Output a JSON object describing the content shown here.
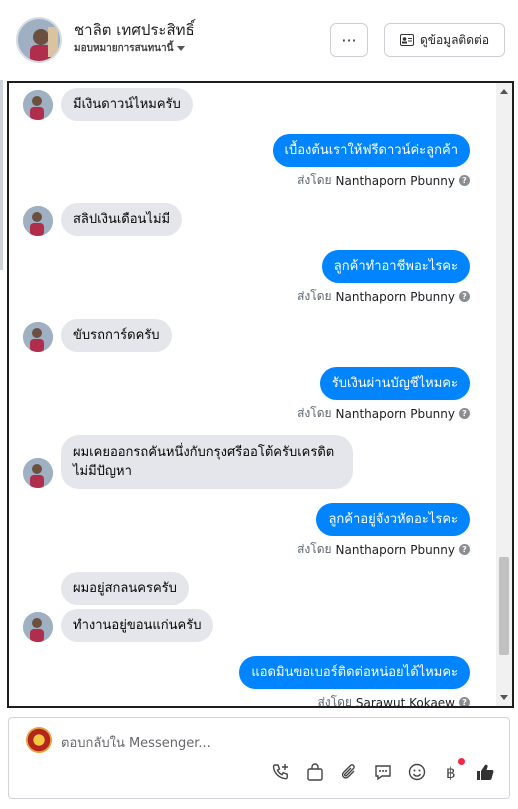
{
  "header": {
    "name": "ชาลิต เทศประสิทธิ์",
    "assigned": "มอบหมายการสนทนานี้",
    "more_label": "···",
    "contact_label": "ดูข้อมูลติดต่อ"
  },
  "messages": [
    {
      "dir": "in",
      "text": "มีเงินดาวน์ไหมครับ"
    },
    {
      "dir": "out",
      "text": "เบื้องต้นเราให้ฟรีดาวน์ค่ะลูกค้า",
      "sent_by_prefix": "ส่งโดย",
      "sender": "Nanthaporn Pbunny"
    },
    {
      "dir": "in",
      "text": "สลิปเงินเดือนไม่มี"
    },
    {
      "dir": "out",
      "text": "ลูกค้าทำอาชีพอะไรคะ",
      "sent_by_prefix": "ส่งโดย",
      "sender": "Nanthaporn Pbunny"
    },
    {
      "dir": "in",
      "text": "ขับรถการ์ดครับ"
    },
    {
      "dir": "out",
      "text": "รับเงินผ่านบัญชีไหมคะ",
      "sent_by_prefix": "ส่งโดย",
      "sender": "Nanthaporn Pbunny"
    },
    {
      "dir": "in",
      "text": "ผมเคยออกรถคันหนึ่งกับกรุงศรีออโต้ครับเครดิตไม่มีปัญหา"
    },
    {
      "dir": "out",
      "text": "ลูกค้าอยู่จังวหัดอะไรคะ",
      "sent_by_prefix": "ส่งโดย",
      "sender": "Nanthaporn Pbunny"
    },
    {
      "dir": "in",
      "text": "ผมอยู่สกลนครครับ"
    },
    {
      "dir": "in",
      "text": "ทำงานอยู่ขอนแก่นครับ"
    },
    {
      "dir": "out",
      "text": "แอดมินขอเบอร์ติดต่อหน่อยได้ไหมคะ",
      "sent_by_prefix": "ส่งโดย",
      "sender": "Sarawut Kokaew"
    }
  ],
  "composer": {
    "placeholder": "ตอบกลับใน Messenger..."
  },
  "icons": {
    "tools": [
      "phone-plus-icon",
      "shopping-bag-icon",
      "paperclip-icon",
      "chat-bubble-icon",
      "smiley-icon",
      "baht-icon",
      "thumbs-up-icon"
    ],
    "accent": "#0084ff",
    "notification": "#f02849"
  }
}
